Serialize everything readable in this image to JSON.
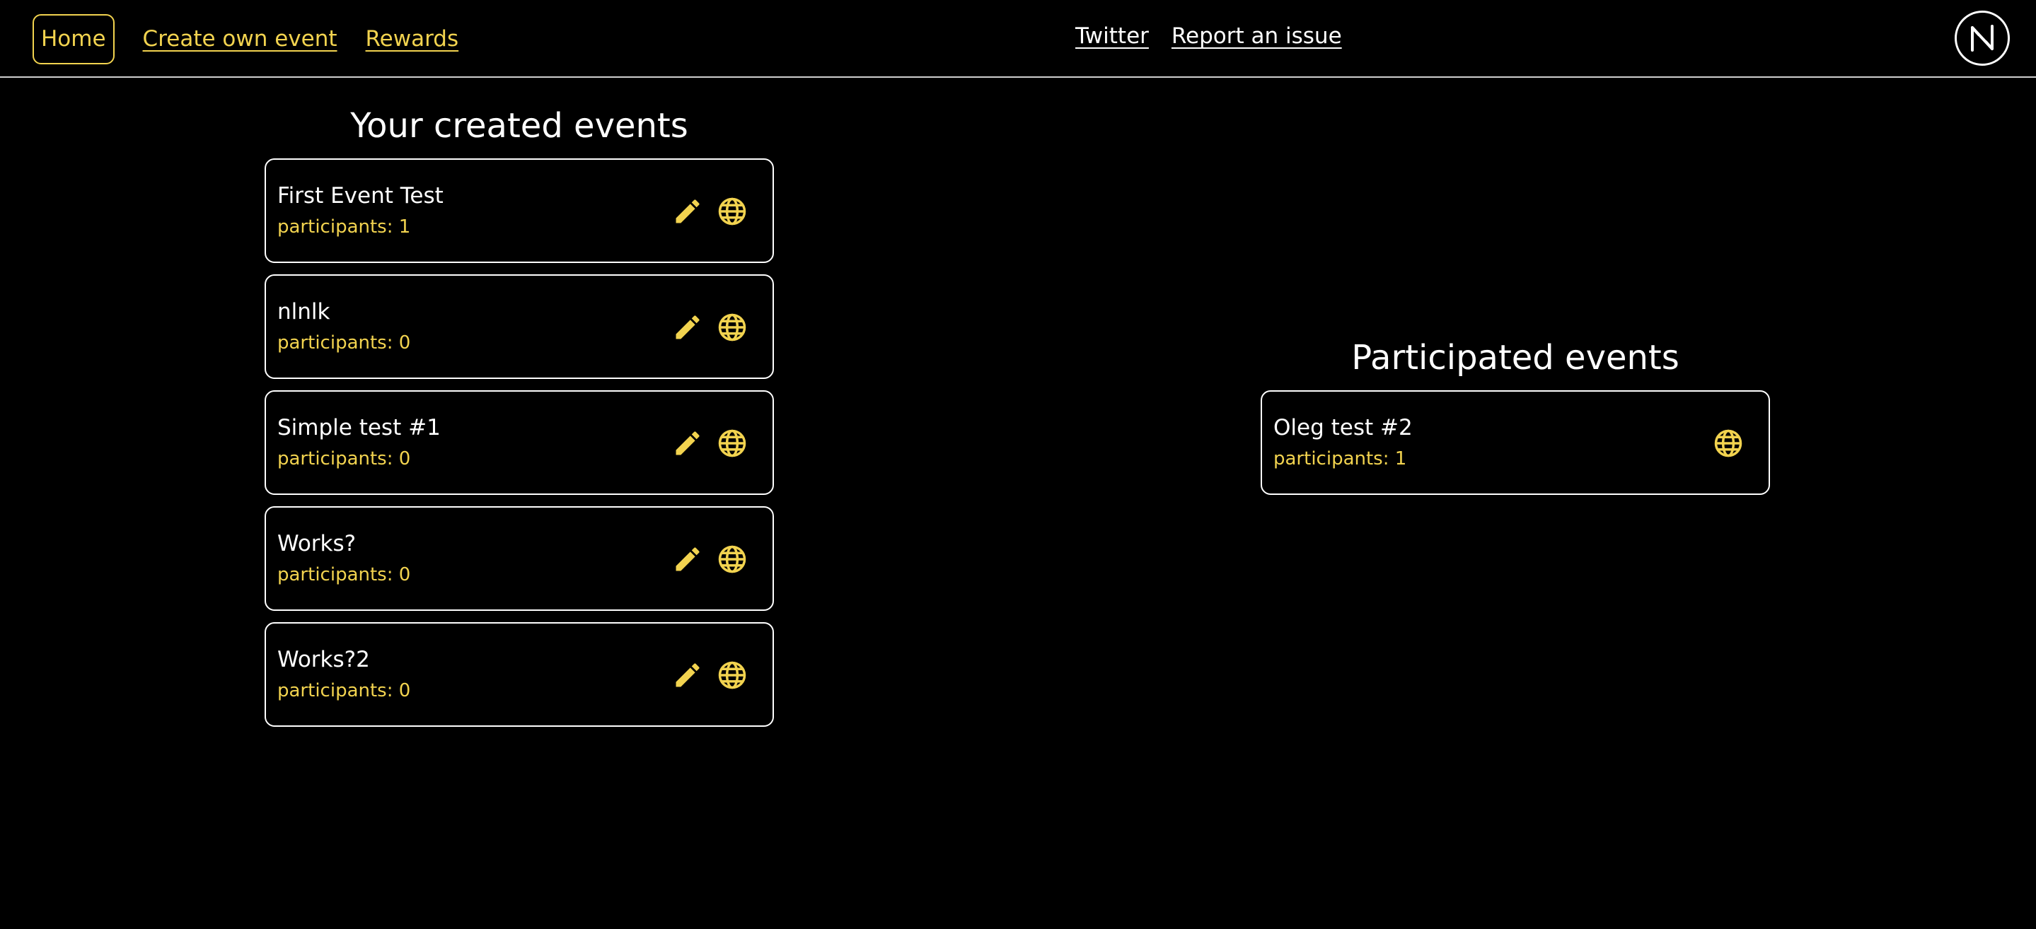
{
  "nav": {
    "home": "Home",
    "create": "Create own event",
    "rewards": "Rewards",
    "twitter": "Twitter",
    "report": "Report an issue"
  },
  "created": {
    "title": "Your created events",
    "events": [
      {
        "name": "First Event Test",
        "participants": "participants: 1"
      },
      {
        "name": "nlnlk",
        "participants": "participants: 0"
      },
      {
        "name": "Simple test #1",
        "participants": "participants: 0"
      },
      {
        "name": "Works?",
        "participants": "participants: 0"
      },
      {
        "name": "Works?2",
        "participants": "participants: 0"
      }
    ]
  },
  "participated": {
    "title": "Participated events",
    "events": [
      {
        "name": "Oleg test #2",
        "participants": "participants: 1"
      }
    ]
  },
  "colors": {
    "accent": "#f2d34f",
    "background": "#000000",
    "border": "#ffffff"
  },
  "icons": {
    "edit": "pencil-icon",
    "open": "globe-icon",
    "logo": "near-logo-icon"
  }
}
